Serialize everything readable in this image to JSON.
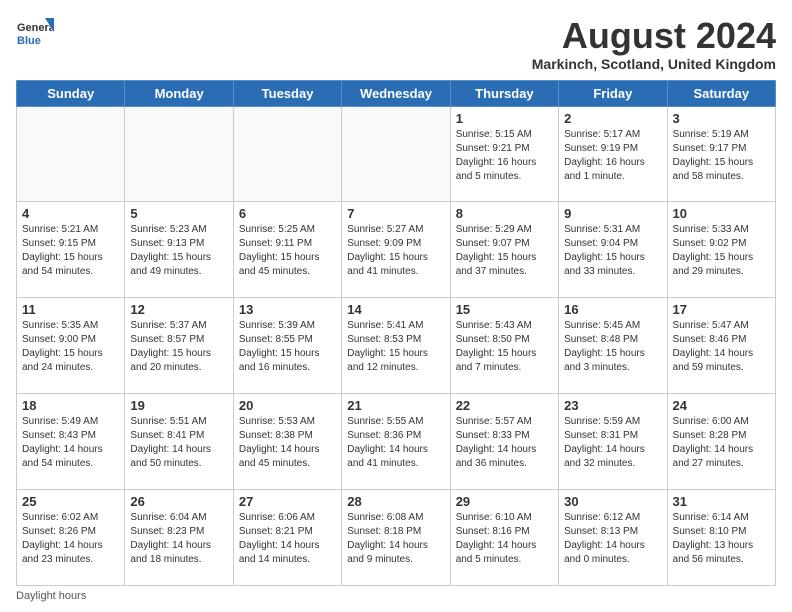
{
  "header": {
    "logo_general": "General",
    "logo_blue": "Blue",
    "month_title": "August 2024",
    "location": "Markinch, Scotland, United Kingdom"
  },
  "weekdays": [
    "Sunday",
    "Monday",
    "Tuesday",
    "Wednesday",
    "Thursday",
    "Friday",
    "Saturday"
  ],
  "footer": {
    "note": "Daylight hours"
  },
  "weeks": [
    [
      {
        "day": "",
        "info": ""
      },
      {
        "day": "",
        "info": ""
      },
      {
        "day": "",
        "info": ""
      },
      {
        "day": "",
        "info": ""
      },
      {
        "day": "1",
        "info": "Sunrise: 5:15 AM\nSunset: 9:21 PM\nDaylight: 16 hours\nand 5 minutes."
      },
      {
        "day": "2",
        "info": "Sunrise: 5:17 AM\nSunset: 9:19 PM\nDaylight: 16 hours\nand 1 minute."
      },
      {
        "day": "3",
        "info": "Sunrise: 5:19 AM\nSunset: 9:17 PM\nDaylight: 15 hours\nand 58 minutes."
      }
    ],
    [
      {
        "day": "4",
        "info": "Sunrise: 5:21 AM\nSunset: 9:15 PM\nDaylight: 15 hours\nand 54 minutes."
      },
      {
        "day": "5",
        "info": "Sunrise: 5:23 AM\nSunset: 9:13 PM\nDaylight: 15 hours\nand 49 minutes."
      },
      {
        "day": "6",
        "info": "Sunrise: 5:25 AM\nSunset: 9:11 PM\nDaylight: 15 hours\nand 45 minutes."
      },
      {
        "day": "7",
        "info": "Sunrise: 5:27 AM\nSunset: 9:09 PM\nDaylight: 15 hours\nand 41 minutes."
      },
      {
        "day": "8",
        "info": "Sunrise: 5:29 AM\nSunset: 9:07 PM\nDaylight: 15 hours\nand 37 minutes."
      },
      {
        "day": "9",
        "info": "Sunrise: 5:31 AM\nSunset: 9:04 PM\nDaylight: 15 hours\nand 33 minutes."
      },
      {
        "day": "10",
        "info": "Sunrise: 5:33 AM\nSunset: 9:02 PM\nDaylight: 15 hours\nand 29 minutes."
      }
    ],
    [
      {
        "day": "11",
        "info": "Sunrise: 5:35 AM\nSunset: 9:00 PM\nDaylight: 15 hours\nand 24 minutes."
      },
      {
        "day": "12",
        "info": "Sunrise: 5:37 AM\nSunset: 8:57 PM\nDaylight: 15 hours\nand 20 minutes."
      },
      {
        "day": "13",
        "info": "Sunrise: 5:39 AM\nSunset: 8:55 PM\nDaylight: 15 hours\nand 16 minutes."
      },
      {
        "day": "14",
        "info": "Sunrise: 5:41 AM\nSunset: 8:53 PM\nDaylight: 15 hours\nand 12 minutes."
      },
      {
        "day": "15",
        "info": "Sunrise: 5:43 AM\nSunset: 8:50 PM\nDaylight: 15 hours\nand 7 minutes."
      },
      {
        "day": "16",
        "info": "Sunrise: 5:45 AM\nSunset: 8:48 PM\nDaylight: 15 hours\nand 3 minutes."
      },
      {
        "day": "17",
        "info": "Sunrise: 5:47 AM\nSunset: 8:46 PM\nDaylight: 14 hours\nand 59 minutes."
      }
    ],
    [
      {
        "day": "18",
        "info": "Sunrise: 5:49 AM\nSunset: 8:43 PM\nDaylight: 14 hours\nand 54 minutes."
      },
      {
        "day": "19",
        "info": "Sunrise: 5:51 AM\nSunset: 8:41 PM\nDaylight: 14 hours\nand 50 minutes."
      },
      {
        "day": "20",
        "info": "Sunrise: 5:53 AM\nSunset: 8:38 PM\nDaylight: 14 hours\nand 45 minutes."
      },
      {
        "day": "21",
        "info": "Sunrise: 5:55 AM\nSunset: 8:36 PM\nDaylight: 14 hours\nand 41 minutes."
      },
      {
        "day": "22",
        "info": "Sunrise: 5:57 AM\nSunset: 8:33 PM\nDaylight: 14 hours\nand 36 minutes."
      },
      {
        "day": "23",
        "info": "Sunrise: 5:59 AM\nSunset: 8:31 PM\nDaylight: 14 hours\nand 32 minutes."
      },
      {
        "day": "24",
        "info": "Sunrise: 6:00 AM\nSunset: 8:28 PM\nDaylight: 14 hours\nand 27 minutes."
      }
    ],
    [
      {
        "day": "25",
        "info": "Sunrise: 6:02 AM\nSunset: 8:26 PM\nDaylight: 14 hours\nand 23 minutes."
      },
      {
        "day": "26",
        "info": "Sunrise: 6:04 AM\nSunset: 8:23 PM\nDaylight: 14 hours\nand 18 minutes."
      },
      {
        "day": "27",
        "info": "Sunrise: 6:06 AM\nSunset: 8:21 PM\nDaylight: 14 hours\nand 14 minutes."
      },
      {
        "day": "28",
        "info": "Sunrise: 6:08 AM\nSunset: 8:18 PM\nDaylight: 14 hours\nand 9 minutes."
      },
      {
        "day": "29",
        "info": "Sunrise: 6:10 AM\nSunset: 8:16 PM\nDaylight: 14 hours\nand 5 minutes."
      },
      {
        "day": "30",
        "info": "Sunrise: 6:12 AM\nSunset: 8:13 PM\nDaylight: 14 hours\nand 0 minutes."
      },
      {
        "day": "31",
        "info": "Sunrise: 6:14 AM\nSunset: 8:10 PM\nDaylight: 13 hours\nand 56 minutes."
      }
    ]
  ]
}
